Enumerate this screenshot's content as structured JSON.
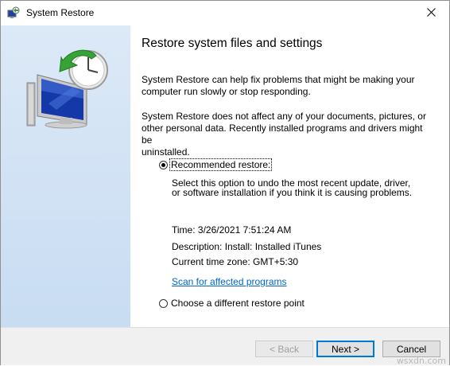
{
  "window": {
    "title": "System Restore",
    "close_glyph": "✕"
  },
  "content": {
    "heading": "Restore system files and settings",
    "para1_line1": "System Restore can help fix problems that might be making your",
    "para1_line2": "computer run slowly or stop responding.",
    "para2_line1": "System Restore does not affect any of your documents, pictures, or",
    "para2_line2": "other personal data. Recently installed programs and drivers might be",
    "para2_line3": "uninstalled.",
    "recommended": {
      "label": "Recommended restore:",
      "selected": true,
      "desc_line1": "Select this option to undo the most recent update, driver,",
      "desc_line2": "or software installation if you think it is causing problems.",
      "time": "Time: 3/26/2021 7:51:24 AM",
      "description": "Description: Install: Installed iTunes",
      "timezone": "Current time zone: GMT+5:30",
      "scan_link": "Scan for affected programs"
    },
    "different": {
      "label": "Choose a different restore point",
      "selected": false
    }
  },
  "footer": {
    "back_label": "< Back",
    "next_label": "Next >",
    "cancel_label": "Cancel"
  },
  "watermark": "wsxdn.com",
  "colors": {
    "link": "#0066cc",
    "sidebar_top": "#dce9f7",
    "sidebar_bottom": "#c8dcf2",
    "default_button_border": "#0078d7"
  },
  "icons": {
    "title": "system-restore-icon",
    "close": "close-icon",
    "hero": "computer-clock-restore-icon"
  }
}
